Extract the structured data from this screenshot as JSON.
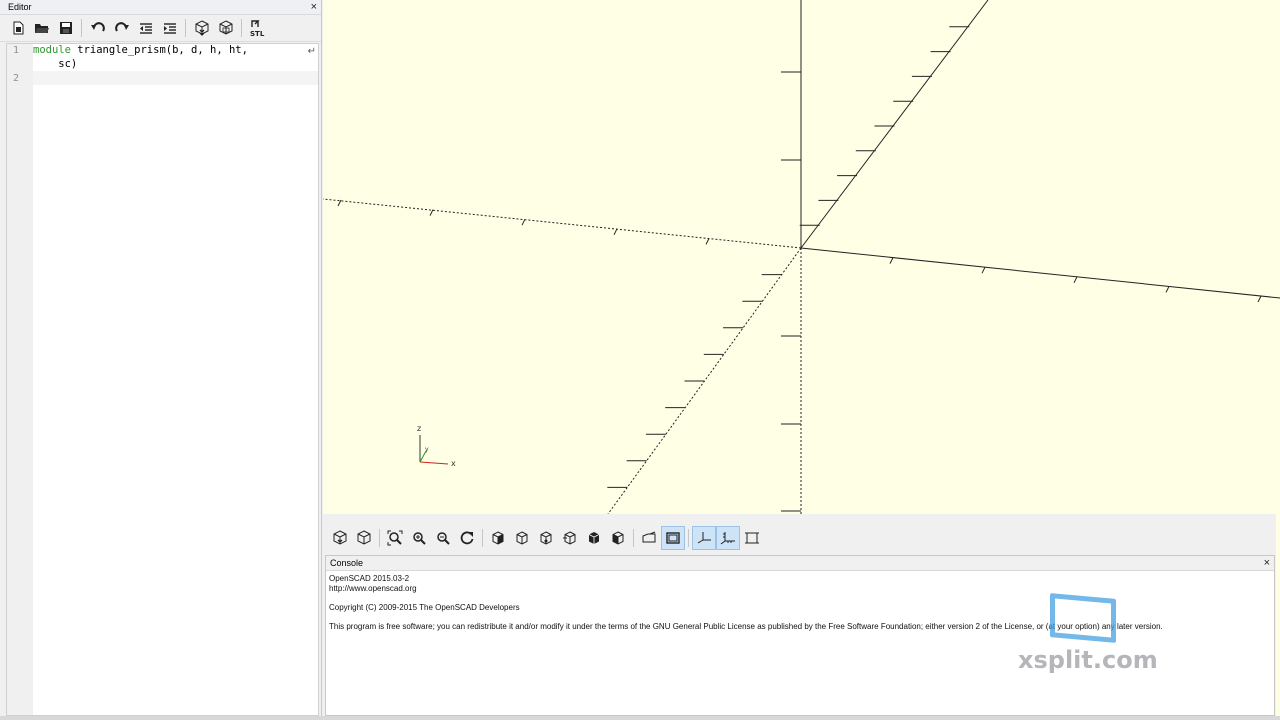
{
  "editor": {
    "title": "Editor",
    "close_label": "×",
    "toolbar_icons": [
      "new-file-icon",
      "open-file-icon",
      "save-icon",
      "undo-icon",
      "redo-icon",
      "unindent-icon",
      "indent-icon",
      "preview-icon",
      "render-icon",
      "export-stl-icon"
    ],
    "stl_label": "STL",
    "lines": [
      {
        "number": "1",
        "keyword": "module",
        "text": " triangle_prism(b, d, h, ht,"
      },
      {
        "number": "",
        "keyword": "",
        "text": "    sc)"
      },
      {
        "number": "2",
        "keyword": "",
        "text": ""
      }
    ],
    "wrap_marker": "↵"
  },
  "viewport": {
    "background": "#ffffe6",
    "axis_indicator": {
      "z": "z",
      "y": "y",
      "x": "x"
    }
  },
  "view_toolbar": {
    "icons": [
      "preview-icon",
      "render-icon",
      "view-all-icon",
      "zoom-in-icon",
      "zoom-out-icon",
      "reset-view-icon",
      "view-right-icon",
      "view-top-icon",
      "view-bottom-icon",
      "view-left-icon",
      "view-front-icon",
      "view-back-icon",
      "perspective-icon",
      "orthogonal-icon",
      "show-axes-icon",
      "show-scale-markers-icon",
      "show-edges-icon"
    ],
    "active": [
      "orthogonal-icon",
      "show-axes-icon",
      "show-scale-markers-icon"
    ]
  },
  "console": {
    "title": "Console",
    "close_label": "×",
    "lines": [
      "OpenSCAD 2015.03-2",
      "http://www.openscad.org",
      "",
      "Copyright (C) 2009-2015 The OpenSCAD Developers",
      "",
      "This program is free software; you can redistribute it and/or modify it under the terms of the GNU General Public License as published by the Free Software Foundation; either version 2 of the License, or (at your option) any later version."
    ]
  },
  "watermark": {
    "text": "xsplit.com"
  }
}
